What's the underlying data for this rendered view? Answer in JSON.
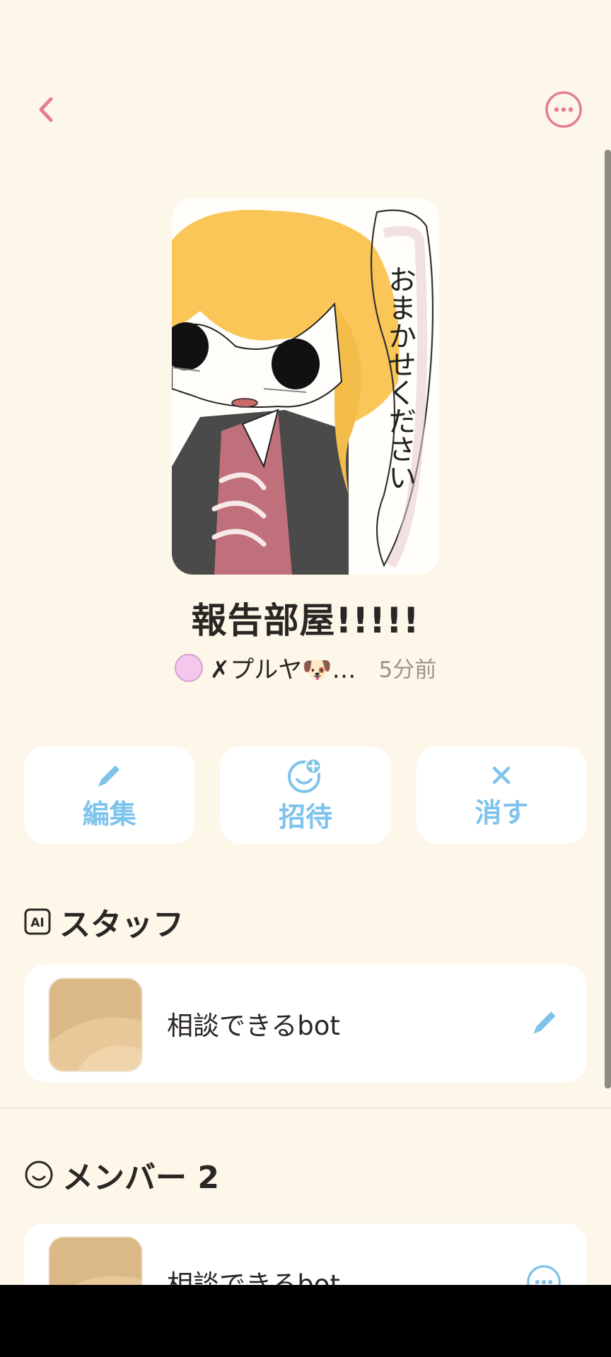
{
  "header": {
    "back_icon": "chevron-left-icon",
    "more_icon": "more-circle-icon"
  },
  "room": {
    "title": "報告部屋!!!!!",
    "owner_name": "✗プルヤ🐶…",
    "time": "5分前",
    "cover_text": "おまかせください"
  },
  "actions": [
    {
      "label": "編集",
      "icon": "pencil-icon"
    },
    {
      "label": "招待",
      "icon": "add-user-icon"
    },
    {
      "label": "消す",
      "icon": "close-icon"
    }
  ],
  "staff": {
    "heading": "スタッフ",
    "badge": "AI",
    "items": [
      {
        "name": "相談できるbot",
        "action_icon": "pencil-icon"
      }
    ]
  },
  "members": {
    "heading": "メンバー 2",
    "items": [
      {
        "name": "相談できるbot",
        "action_icon": "more-circle-icon"
      }
    ]
  },
  "colors": {
    "background": "#fdf7ea",
    "accent_pink": "#e57f8e",
    "accent_blue": "#7ec3ec",
    "text": "#2b2623"
  }
}
